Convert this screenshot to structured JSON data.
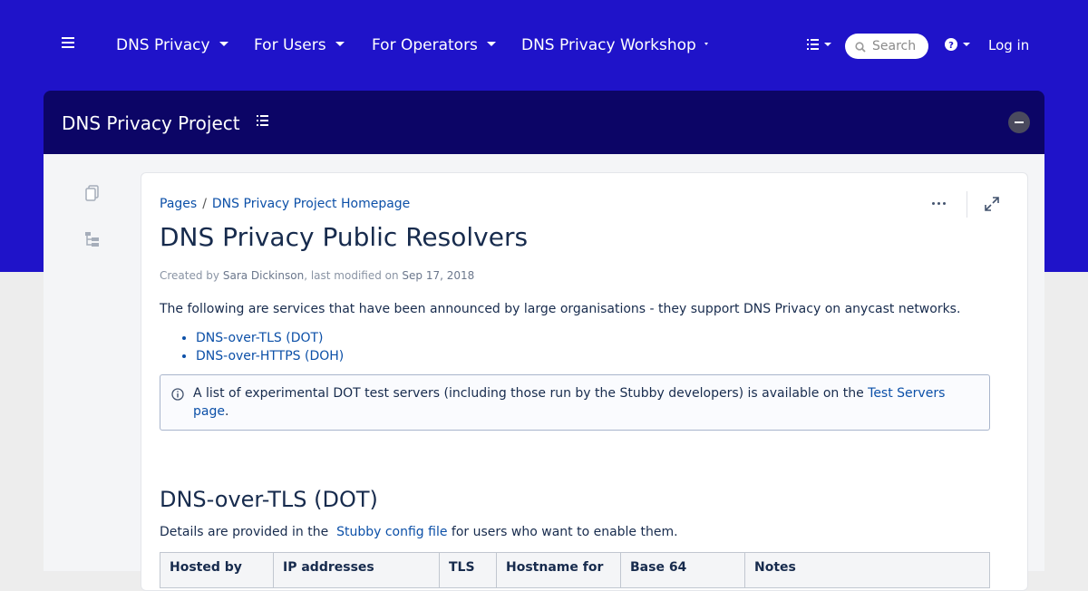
{
  "topnav": {
    "items": [
      {
        "label": "DNS Privacy"
      },
      {
        "label": "For Users"
      },
      {
        "label": "For Operators"
      },
      {
        "label": "DNS Privacy Workshop"
      }
    ],
    "search_placeholder": "Search",
    "login_label": "Log in"
  },
  "space": {
    "title": "DNS Privacy Project"
  },
  "page": {
    "breadcrumb": [
      "Pages",
      "DNS Privacy Project Homepage"
    ],
    "title": "DNS Privacy Public Resolvers",
    "byline": {
      "created_by_label": "Created by",
      "author": "Sara Dickinson",
      "modified_label": ", last modified on",
      "date": "Sep 17, 2018"
    },
    "intro": "The following are services that have been announced by large organisations -  they support DNS Privacy on anycast networks.",
    "toc": [
      "DNS-over-TLS (DOT)",
      "DNS-over-HTTPS (DOH)"
    ],
    "info_panel": {
      "text": "A list of experimental DOT test servers (including those run by the Stubby developers) is available on the",
      "link": "Test Servers page",
      "suffix": "."
    },
    "section_heading": "DNS-over-TLS (DOT)",
    "details": {
      "prefix": "Details are provided in the ",
      "link": "Stubby config file",
      "suffix": " for users who want to enable them."
    },
    "table_headers": [
      "Hosted by",
      "IP addresses",
      "TLS",
      "Hostname for",
      "Base 64",
      "Notes"
    ]
  },
  "colors": {
    "brand_blue": "#1f13c9",
    "space_header": "#0c05660",
    "link": "#0c50a8"
  },
  "icons": [
    "hamburger-icon",
    "caret-down-icon",
    "list-icon",
    "search-icon",
    "help-icon",
    "space-tree-icon",
    "collapse-icon",
    "pages-icon",
    "hierarchy-icon",
    "more-icon",
    "expand-icon",
    "info-icon"
  ]
}
